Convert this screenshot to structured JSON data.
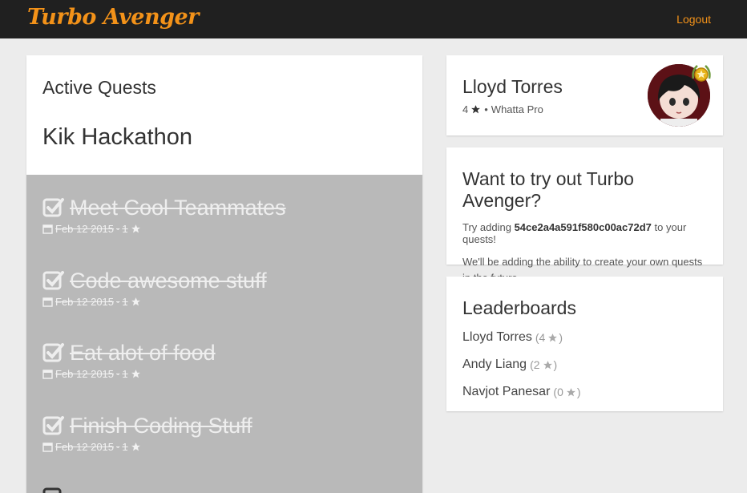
{
  "navbar": {
    "brand": "Turbo Avenger",
    "logout_label": "Logout"
  },
  "quests": {
    "title": "Active Quests",
    "group": "Kik Hackathon",
    "items": [
      {
        "name": "Meet Cool Teammates",
        "date": "Feb 12 2015",
        "stars": "1",
        "done": true
      },
      {
        "name": "Code awesome stuff",
        "date": "Feb 12 2015",
        "stars": "1",
        "done": true
      },
      {
        "name": "Eat alot of food",
        "date": "Feb 12 2015",
        "stars": "1",
        "done": true
      },
      {
        "name": "Finish Coding Stuff",
        "date": "Feb 12 2015",
        "stars": "1",
        "done": true
      }
    ]
  },
  "profile": {
    "name": "Lloyd Torres",
    "stars": "4",
    "separator": "•",
    "level": "Whatta Pro"
  },
  "tryout": {
    "title": "Want to try out Turbo Avenger?",
    "line_prefix": "Try adding",
    "code": "54ce2a4a591f580c00ac72d7",
    "line_suffix": "to your quests!",
    "note": "We'll be adding the ability to create your own quests in the future."
  },
  "leaderboards": {
    "title": "Leaderboards",
    "entries": [
      {
        "name": "Lloyd Torres",
        "score": "4"
      },
      {
        "name": "Andy Liang",
        "score": "2"
      },
      {
        "name": "Navjot Panesar",
        "score": "0"
      }
    ]
  },
  "colors": {
    "brand": "#f39219",
    "navbar": "#202020",
    "background": "#ececec",
    "completed_panel": "#b9b9b9"
  }
}
